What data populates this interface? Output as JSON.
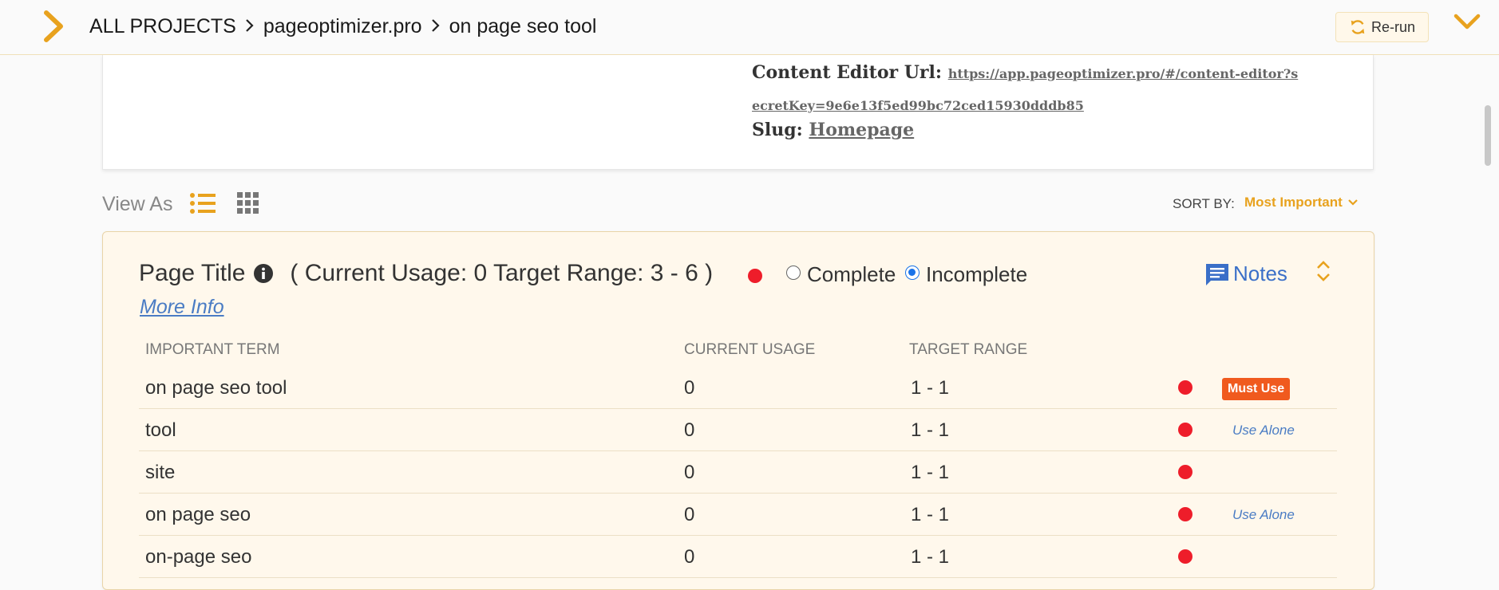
{
  "header": {
    "breadcrumb": [
      "ALL PROJECTS",
      "pageoptimizer.pro",
      "on page seo tool"
    ],
    "rerun_label": "Re-run"
  },
  "info": {
    "content_editor_label": "Content Editor Url:",
    "content_editor_url_line1": "https://app.pageoptimizer.pro/#/content-editor?s",
    "content_editor_url_line2": "ecretKey=9e6e13f5ed99bc72ced15930dddb85",
    "slug_label": "Slug:",
    "slug_value": "Homepage"
  },
  "view": {
    "label": "View As",
    "sort_label": "SORT BY:",
    "sort_value": "Most Important"
  },
  "section": {
    "title": "Page Title",
    "usage_text": "( Current Usage: 0 Target Range: 3 - 6 )",
    "complete_label": "Complete",
    "incomplete_label": "Incomplete",
    "selected": "Incomplete",
    "notes_label": "Notes",
    "more_info": "More Info",
    "columns": [
      "IMPORTANT TERM",
      "CURRENT USAGE",
      "TARGET RANGE"
    ],
    "rows": [
      {
        "term": "on page seo tool",
        "usage": "0",
        "range": "1 - 1",
        "tag": "Must Use"
      },
      {
        "term": "tool",
        "usage": "0",
        "range": "1 - 1",
        "tag": "Use Alone"
      },
      {
        "term": "site",
        "usage": "0",
        "range": "1 - 1",
        "tag": ""
      },
      {
        "term": "on page seo",
        "usage": "0",
        "range": "1 - 1",
        "tag": "Use Alone"
      },
      {
        "term": "on-page seo",
        "usage": "0",
        "range": "1 - 1",
        "tag": ""
      }
    ]
  },
  "colors": {
    "accent": "#e8a21e",
    "status_red": "#ee1d2a",
    "link_blue": "#4a7cc4",
    "must_use": "#f05a1e"
  },
  "icons": [
    "menu-chevron-icon",
    "refresh-icon",
    "chevron-down-icon",
    "list-view-icon",
    "grid-view-icon",
    "info-icon",
    "notes-icon",
    "collapse-icon"
  ]
}
